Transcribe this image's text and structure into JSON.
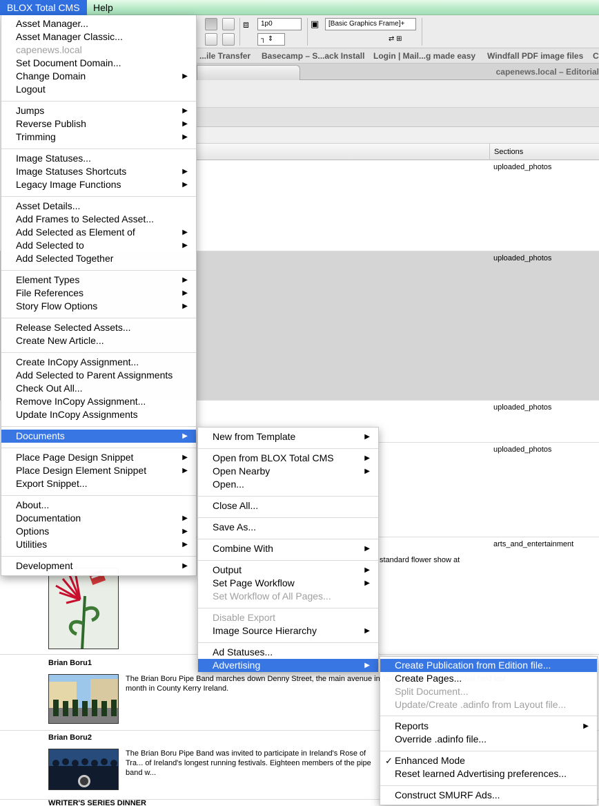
{
  "menubar": {
    "app": "BLOX Total CMS",
    "help": "Help"
  },
  "toolbar": {
    "field_spacing": "1p0",
    "frame_style": "[Basic Graphics Frame]+"
  },
  "bookmarks": [
    "...ile Transfer",
    "Basecamp – S...ack Install",
    "Login | Mail...g made easy",
    "Windfall PDF image files",
    "C"
  ],
  "window_title": "capenews.local – Editorial",
  "table": {
    "sections_header": "Sections",
    "rows": [
      {
        "section": "uploaded_photos"
      },
      {
        "section": "uploaded_photos"
      },
      {
        "section": "uploaded_photos"
      },
      {
        "section": "uploaded_photos"
      },
      {
        "section": "arts_and_entertainment",
        "desc": "standard flower show at"
      },
      {
        "title": "Brian Boru1",
        "desc": "The Brian Boru Pipe Band marches down Denny Street, the main avenue in Tralee International Festival held last month in County Kerry Ireland."
      },
      {
        "title": "Brian Boru2",
        "desc": "The Brian Boru Pipe Band was invited to participate in Ireland's Rose of Tra... of Ireland's longest running festivals. Eighteen members of the pipe band w..."
      },
      {
        "title": "WRITER'S SERIES DINNER"
      }
    ]
  },
  "main_menu": {
    "items": [
      {
        "label": "Asset Manager..."
      },
      {
        "label": "Asset Manager Classic..."
      },
      {
        "label": "capenews.local",
        "disabled": true
      },
      {
        "label": "Set Document Domain..."
      },
      {
        "label": "Change Domain",
        "submenu": true
      },
      {
        "label": "Logout"
      },
      {
        "label": "Jumps",
        "submenu": true
      },
      {
        "label": "Reverse Publish",
        "submenu": true
      },
      {
        "label": "Trimming",
        "submenu": true
      },
      {
        "label": "Image Statuses..."
      },
      {
        "label": "Image Statuses Shortcuts",
        "submenu": true
      },
      {
        "label": "Legacy Image Functions",
        "submenu": true
      },
      {
        "label": "Asset Details..."
      },
      {
        "label": "Add Frames to Selected Asset..."
      },
      {
        "label": "Add Selected as Element of",
        "submenu": true
      },
      {
        "label": "Add Selected to",
        "submenu": true
      },
      {
        "label": "Add Selected Together"
      },
      {
        "label": "Element Types",
        "submenu": true
      },
      {
        "label": "File References",
        "submenu": true
      },
      {
        "label": "Story Flow Options",
        "submenu": true
      },
      {
        "label": "Release Selected Assets..."
      },
      {
        "label": "Create New Article..."
      },
      {
        "label": "Create InCopy Assignment..."
      },
      {
        "label": "Add Selected to Parent Assignments"
      },
      {
        "label": "Check Out All..."
      },
      {
        "label": "Remove InCopy Assignment..."
      },
      {
        "label": "Update InCopy Assignments"
      },
      {
        "label": "Documents",
        "submenu": true,
        "highlight": true
      },
      {
        "label": "Place Page Design Snippet",
        "submenu": true
      },
      {
        "label": "Place Design Element Snippet",
        "submenu": true
      },
      {
        "label": "Export Snippet..."
      },
      {
        "label": "About..."
      },
      {
        "label": "Documentation",
        "submenu": true
      },
      {
        "label": "Options",
        "submenu": true
      },
      {
        "label": "Utilities",
        "submenu": true
      },
      {
        "label": "Development",
        "submenu": true
      }
    ]
  },
  "documents_menu": {
    "items": [
      {
        "label": "New from Template",
        "submenu": true
      },
      {
        "label": "Open from BLOX Total CMS",
        "submenu": true
      },
      {
        "label": "Open Nearby",
        "submenu": true
      },
      {
        "label": "Open..."
      },
      {
        "label": "Close All..."
      },
      {
        "label": "Save As..."
      },
      {
        "label": "Combine With",
        "submenu": true
      },
      {
        "label": "Output",
        "submenu": true
      },
      {
        "label": "Set Page Workflow",
        "submenu": true
      },
      {
        "label": "Set Workflow of All Pages...",
        "disabled": true
      },
      {
        "label": "Disable Export",
        "disabled": true
      },
      {
        "label": "Image Source Hierarchy",
        "submenu": true
      },
      {
        "label": "Ad Statuses..."
      },
      {
        "label": "Advertising",
        "submenu": true,
        "highlight": true
      }
    ]
  },
  "advertising_menu": {
    "items": [
      {
        "label": "Create Publication from Edition file...",
        "highlight": true
      },
      {
        "label": "Create Pages..."
      },
      {
        "label": "Split Document...",
        "disabled": true
      },
      {
        "label": "Update/Create .adinfo from Layout file...",
        "disabled": true
      },
      {
        "label": "Reports",
        "submenu": true
      },
      {
        "label": "Override .adinfo file..."
      },
      {
        "label": "Enhanced Mode",
        "checked": true
      },
      {
        "label": "Reset learned Advertising preferences..."
      },
      {
        "label": "Construct SMURF Ads..."
      }
    ],
    "check_glyph": "✓"
  },
  "glyphs": {
    "submenu_arrow": "▶"
  }
}
